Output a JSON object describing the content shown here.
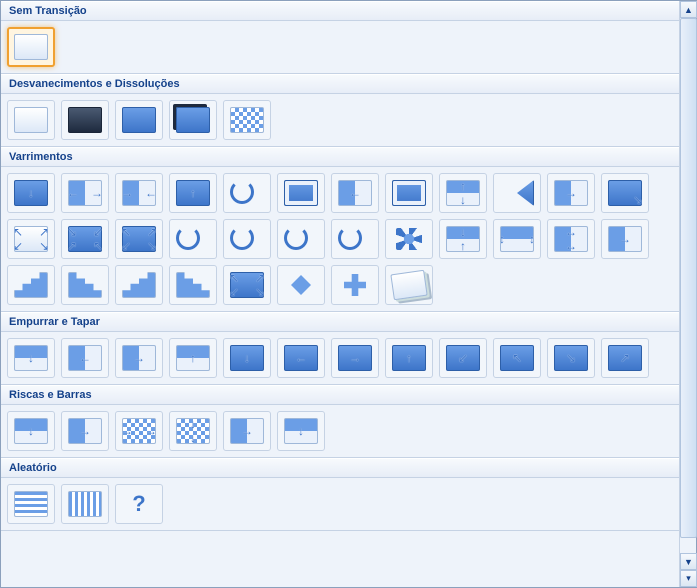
{
  "groups": [
    {
      "key": "no_transition",
      "title": "Sem Transição",
      "items": [
        {
          "name": "none",
          "selected": true,
          "style": "plain"
        }
      ]
    },
    {
      "key": "fades",
      "title": "Desvanecimentos e Dissoluções",
      "items": [
        {
          "name": "fade-smoothly",
          "style": "stacked-plain"
        },
        {
          "name": "fade-through-black",
          "style": "stacked-dark"
        },
        {
          "name": "cut",
          "style": "stacked-fill"
        },
        {
          "name": "cut-through-black",
          "style": "stacked-fill-dark"
        },
        {
          "name": "dissolve",
          "style": "checker"
        }
      ]
    },
    {
      "key": "wipes",
      "title": "Varrimentos",
      "items": [
        {
          "name": "wipe-down",
          "style": "fill",
          "arrows": [
            [
              "c",
              "↓"
            ]
          ]
        },
        {
          "name": "split-horizontal-out",
          "style": "half-v",
          "arrows": [
            [
              "l",
              "←"
            ],
            [
              "r",
              "→"
            ]
          ]
        },
        {
          "name": "split-horizontal-in",
          "style": "half-v",
          "arrows": [
            [
              "l",
              "→"
            ],
            [
              "r",
              "←"
            ]
          ]
        },
        {
          "name": "wipe-up",
          "style": "fill",
          "arrows": [
            [
              "c",
              "↑"
            ]
          ]
        },
        {
          "name": "wheel-1-spoke",
          "style": "circ"
        },
        {
          "name": "box-out",
          "style": "fill-inset",
          "arrows": []
        },
        {
          "name": "wipe-left",
          "style": "half-v",
          "arrows": [
            [
              "c",
              "←"
            ]
          ]
        },
        {
          "name": "box-in",
          "style": "fill-inset2",
          "arrows": []
        },
        {
          "name": "split-vertical-out",
          "style": "half-h",
          "arrows": [
            [
              "t",
              "↑"
            ],
            [
              "b",
              "↓"
            ]
          ]
        },
        {
          "name": "wedge",
          "style": "wedge"
        },
        {
          "name": "uncover-right",
          "style": "half-v",
          "arrows": [
            [
              "c",
              "→"
            ]
          ]
        },
        {
          "name": "uncover-left-down",
          "style": "fill",
          "arrows": [
            [
              "br",
              "↘"
            ]
          ]
        },
        {
          "name": "shape-out",
          "style": "plain",
          "arrows": [
            [
              "tl",
              "↖"
            ],
            [
              "tr",
              "↗"
            ],
            [
              "bl",
              "↙"
            ],
            [
              "br",
              "↘"
            ]
          ]
        },
        {
          "name": "shape-in",
          "style": "fill",
          "arrows": [
            [
              "tl",
              "↘"
            ],
            [
              "tr",
              "↙"
            ],
            [
              "bl",
              "↗"
            ],
            [
              "br",
              "↖"
            ]
          ]
        },
        {
          "name": "shape-diamond-out",
          "style": "fill",
          "arrows": [
            [
              "tl",
              "↖"
            ],
            [
              "tr",
              "↗"
            ],
            [
              "bl",
              "↙"
            ],
            [
              "br",
              "↘"
            ]
          ]
        },
        {
          "name": "wheel-2-spokes",
          "style": "circ"
        },
        {
          "name": "wheel-3-spokes",
          "style": "circ"
        },
        {
          "name": "wheel-4-spokes",
          "style": "circ"
        },
        {
          "name": "wheel-8-spokes",
          "style": "circ"
        },
        {
          "name": "newsflash",
          "style": "newsflash"
        },
        {
          "name": "split-vertical-in",
          "style": "half-h",
          "arrows": [
            [
              "t",
              "↓"
            ],
            [
              "b",
              "↑"
            ]
          ]
        },
        {
          "name": "comb-horizontal",
          "style": "half-h",
          "arrows": [
            [
              "l",
              "↕"
            ],
            [
              "r",
              "↕"
            ]
          ]
        },
        {
          "name": "comb-vertical",
          "style": "half-v",
          "arrows": [
            [
              "t",
              "↔"
            ],
            [
              "b",
              "↔"
            ]
          ]
        },
        {
          "name": "wipe-right",
          "style": "half-v",
          "arrows": [
            [
              "c",
              "→"
            ]
          ]
        },
        {
          "name": "strips-left-down",
          "style": "stairs"
        },
        {
          "name": "strips-left-up",
          "style": "stairs-rev"
        },
        {
          "name": "strips-right-down",
          "style": "stairs"
        },
        {
          "name": "strips-right-up",
          "style": "stairs-rev"
        },
        {
          "name": "shape-circle",
          "style": "fill",
          "arrows": [
            [
              "tl",
              "↖"
            ],
            [
              "tr",
              "↗"
            ],
            [
              "bl",
              "↙"
            ],
            [
              "br",
              "↘"
            ]
          ]
        },
        {
          "name": "shape-diamond",
          "style": "diamond"
        },
        {
          "name": "shape-plus",
          "style": "plus"
        },
        {
          "name": "random-transition-photo",
          "style": "photo"
        }
      ]
    },
    {
      "key": "push_cover",
      "title": "Empurrar e Tapar",
      "items": [
        {
          "name": "push-down",
          "style": "half-h",
          "arrows": [
            [
              "c",
              "↓"
            ]
          ]
        },
        {
          "name": "push-left",
          "style": "half-v",
          "arrows": [
            [
              "c",
              "←"
            ]
          ]
        },
        {
          "name": "push-right",
          "style": "half-v",
          "arrows": [
            [
              "c",
              "→"
            ]
          ]
        },
        {
          "name": "push-up",
          "style": "half-h",
          "arrows": [
            [
              "c",
              "↑"
            ]
          ]
        },
        {
          "name": "cover-down",
          "style": "fill-over",
          "arrows": [
            [
              "c",
              "↓"
            ]
          ]
        },
        {
          "name": "cover-left",
          "style": "fill-over",
          "arrows": [
            [
              "c",
              "←"
            ]
          ]
        },
        {
          "name": "cover-right",
          "style": "fill-over",
          "arrows": [
            [
              "c",
              "→"
            ]
          ]
        },
        {
          "name": "cover-up",
          "style": "fill-over",
          "arrows": [
            [
              "c",
              "↑"
            ]
          ]
        },
        {
          "name": "cover-left-down",
          "style": "fill-over",
          "arrows": [
            [
              "c",
              "↙"
            ]
          ]
        },
        {
          "name": "cover-left-up",
          "style": "fill-over",
          "arrows": [
            [
              "c",
              "↖"
            ]
          ]
        },
        {
          "name": "cover-right-down",
          "style": "fill-over",
          "arrows": [
            [
              "c",
              "↘"
            ]
          ]
        },
        {
          "name": "cover-right-up",
          "style": "fill-over",
          "arrows": [
            [
              "c",
              "↗"
            ]
          ]
        }
      ]
    },
    {
      "key": "stripes_bars",
      "title": "Riscas e Barras",
      "items": [
        {
          "name": "blinds-horizontal",
          "style": "half-h",
          "arrows": [
            [
              "c",
              "↓"
            ]
          ]
        },
        {
          "name": "blinds-vertical",
          "style": "half-v",
          "arrows": [
            [
              "c",
              "→"
            ]
          ]
        },
        {
          "name": "checkerboard-across",
          "style": "checker",
          "arrows": [
            [
              "l",
              "→"
            ],
            [
              "r",
              "→"
            ]
          ]
        },
        {
          "name": "checkerboard-down",
          "style": "checker",
          "arrows": [
            [
              "t",
              "↓"
            ],
            [
              "b",
              "↓"
            ]
          ]
        },
        {
          "name": "comb-horizontal-2",
          "style": "half-v",
          "arrows": [
            [
              "c",
              "→"
            ]
          ]
        },
        {
          "name": "comb-vertical-2",
          "style": "half-h",
          "arrows": [
            [
              "c",
              "↓"
            ]
          ]
        }
      ]
    },
    {
      "key": "random",
      "title": "Aleatório",
      "items": [
        {
          "name": "random-bars-horizontal",
          "style": "stripes-h"
        },
        {
          "name": "random-bars-vertical",
          "style": "stripes-v"
        },
        {
          "name": "random-transition",
          "style": "question"
        }
      ]
    }
  ]
}
